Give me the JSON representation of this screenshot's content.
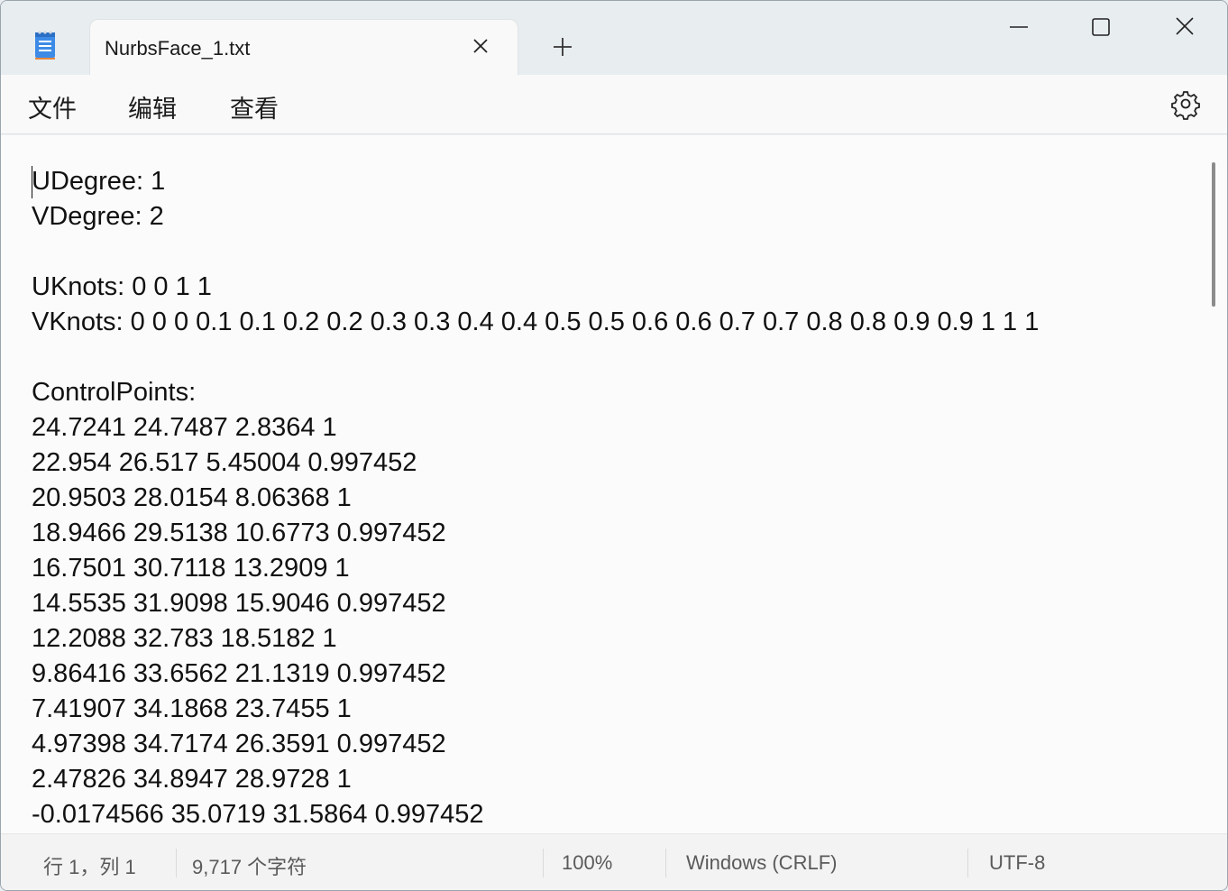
{
  "tab": {
    "title": "NurbsFace_1.txt"
  },
  "menu": {
    "file": "文件",
    "edit": "编辑",
    "view": "查看"
  },
  "editor": {
    "lines": [
      "UDegree: 1",
      "VDegree: 2",
      "",
      "UKnots: 0 0 1 1",
      "VKnots: 0 0 0 0.1 0.1 0.2 0.2 0.3 0.3 0.4 0.4 0.5 0.5 0.6 0.6 0.7 0.7 0.8 0.8 0.9 0.9 1 1 1",
      "",
      "ControlPoints:",
      "24.7241 24.7487 2.8364 1",
      "22.954 26.517 5.45004 0.997452",
      "20.9503 28.0154 8.06368 1",
      "18.9466 29.5138 10.6773 0.997452",
      "16.7501 30.7118 13.2909 1",
      "14.5535 31.9098 15.9046 0.997452",
      "12.2088 32.783 18.5182 1",
      "9.86416 33.6562 21.1319 0.997452",
      "7.41907 34.1868 23.7455 1",
      "4.97398 34.7174 26.3591 0.997452",
      "2.47826 34.8947 28.9728 1",
      "-0.0174566 35.0719 31.5864 0.997452"
    ]
  },
  "status": {
    "position": "行 1，列 1",
    "chars": "9,717 个字符",
    "zoom": "100%",
    "line_ending": "Windows (CRLF)",
    "encoding": "UTF-8"
  },
  "icons": {
    "app": "notepad-icon",
    "close_tab": "close-icon",
    "new_tab": "plus-icon",
    "settings": "gear-icon"
  }
}
